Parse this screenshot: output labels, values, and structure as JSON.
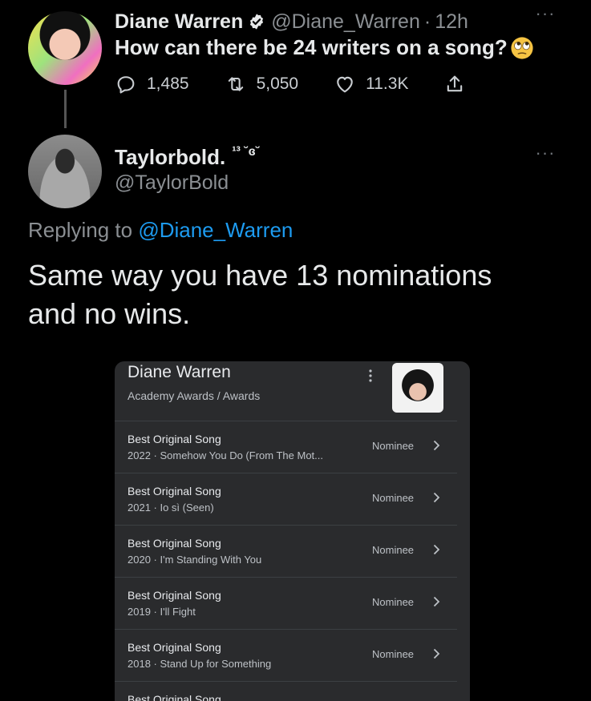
{
  "tweet1": {
    "name": "Diane Warren",
    "handle": "@Diane_Warren",
    "separator": "·",
    "time": "12h",
    "text": "How can there be 24 writers on a song?",
    "emoji": "face-with-rolling-eyes-emoji",
    "replies": "1,485",
    "retweets": "5,050",
    "likes": "11.3K"
  },
  "tweet2": {
    "name": "Taylorbold.",
    "name_badge": "¹³ ˘ɞ˘",
    "handle": "@TaylorBold",
    "replying_prefix": "Replying to",
    "replying_handle": "@Diane_Warren",
    "text": "Same way you have 13 nominations and no wins."
  },
  "card": {
    "title": "Diane Warren",
    "subtitle": "Academy Awards / Awards",
    "rows": [
      {
        "title": "Best Original Song",
        "sub": "2022 · Somehow You Do (From The Mot...",
        "status": "Nominee"
      },
      {
        "title": "Best Original Song",
        "sub": "2021 · Io sì (Seen)",
        "status": "Nominee"
      },
      {
        "title": "Best Original Song",
        "sub": "2020 · I'm Standing With You",
        "status": "Nominee"
      },
      {
        "title": "Best Original Song",
        "sub": "2019 · I'll Fight",
        "status": "Nominee"
      },
      {
        "title": "Best Original Song",
        "sub": "2018 · Stand Up for Something",
        "status": "Nominee"
      },
      {
        "title": "Best Original Song",
        "sub": "",
        "status": ""
      }
    ]
  },
  "colors": {
    "background": "#000000",
    "link": "#1d9bf0",
    "verified": "#e7e9ea",
    "muted": "#8b8f93",
    "card": "#2a2b2d"
  }
}
